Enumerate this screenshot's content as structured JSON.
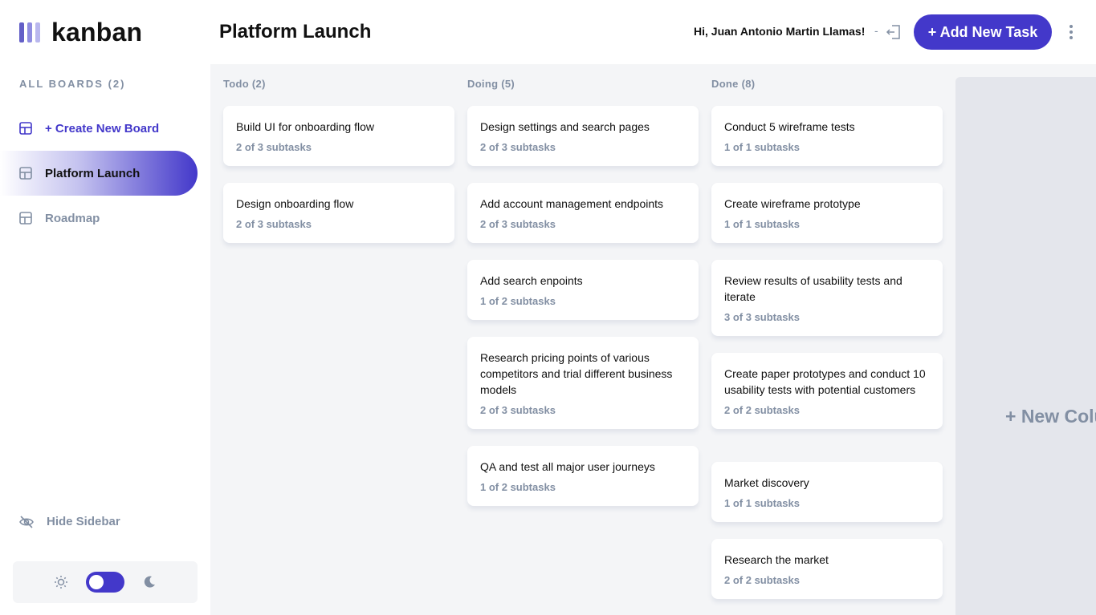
{
  "app": {
    "logo_text": "kanban"
  },
  "sidebar": {
    "boards_heading": "ALL BOARDS (2)",
    "create_label": "+ Create New Board",
    "boards": [
      {
        "label": "Platform Launch",
        "active": true
      },
      {
        "label": "Roadmap",
        "active": false
      }
    ],
    "hide_label": "Hide Sidebar",
    "theme": {
      "mode": "light",
      "icons": [
        "sun-icon",
        "moon-icon"
      ]
    }
  },
  "header": {
    "title": "Platform Launch",
    "greeting": "Hi, Juan Antonio Martin Llamas!",
    "separator": "-",
    "add_task_label": "+ Add New Task"
  },
  "columns": [
    {
      "title": "Todo (2)",
      "tasks": [
        {
          "title": "Build UI for onboarding flow",
          "subtasks": "2 of 3 subtasks"
        },
        {
          "title": "Design onboarding flow",
          "subtasks": "2 of 3 subtasks"
        }
      ]
    },
    {
      "title": "Doing (5)",
      "tasks": [
        {
          "title": "Design settings and search pages",
          "subtasks": "2 of 3 subtasks"
        },
        {
          "title": "Add account management endpoints",
          "subtasks": "2 of 3 subtasks"
        },
        {
          "title": "Add search enpoints",
          "subtasks": "1 of 2 subtasks"
        },
        {
          "title": "Research pricing points of various competitors and trial different business models",
          "subtasks": "2 of 3 subtasks"
        },
        {
          "title": "QA and test all major user journeys",
          "subtasks": "1 of 2 subtasks"
        }
      ]
    },
    {
      "title": "Done (8)",
      "tasks": [
        {
          "title": "Conduct 5 wireframe tests",
          "subtasks": "1 of 1 subtasks"
        },
        {
          "title": "Create wireframe prototype",
          "subtasks": "1 of 1 subtasks"
        },
        {
          "title": "Review results of usability tests and iterate",
          "subtasks": "3 of 3 subtasks"
        },
        {
          "title": "Create paper prototypes and conduct 10 usability tests with potential customers",
          "subtasks": "2 of 2 subtasks"
        },
        {
          "title": "Market discovery",
          "subtasks": "1 of 1 subtasks"
        },
        {
          "title": "Research the market",
          "subtasks": "2 of 2 subtasks"
        }
      ]
    }
  ],
  "new_column_label": "+ New Column",
  "colors": {
    "accent": "#4338ca",
    "muted": "#828fa3",
    "board_bg": "#f4f5f7"
  }
}
